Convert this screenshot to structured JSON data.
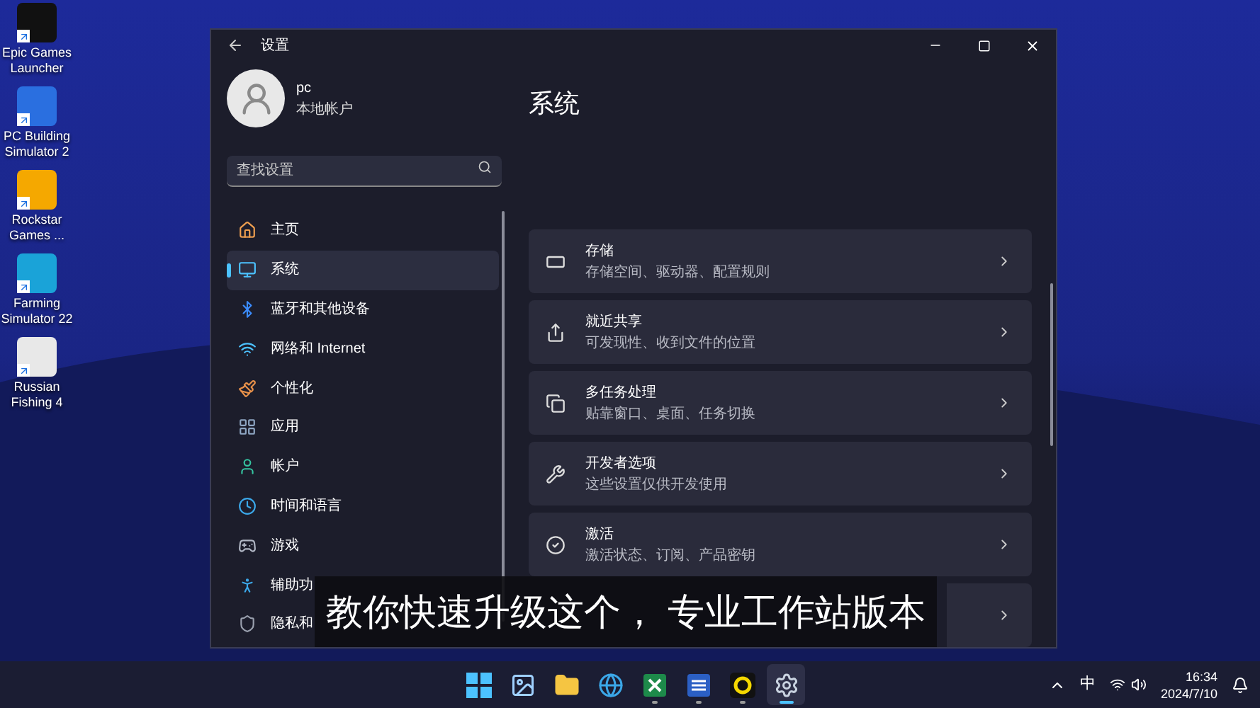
{
  "desktop_icons": [
    {
      "label": "Epic Games Launcher",
      "color": "#111111"
    },
    {
      "label": "PC Building Simulator 2",
      "color": "#2a6fe0"
    },
    {
      "label": "Rockstar Games ...",
      "color": "#f5a800"
    },
    {
      "label": "Farming Simulator 22",
      "color": "#1aa3d8"
    },
    {
      "label": "Russian Fishing 4",
      "color": "#e8e8e8"
    }
  ],
  "window": {
    "title": "设置",
    "user": {
      "name": "pc",
      "account_type": "本地帐户"
    },
    "search": {
      "placeholder": "查找设置"
    },
    "nav_items": [
      {
        "label": "主页",
        "selected": false
      },
      {
        "label": "系统",
        "selected": true
      },
      {
        "label": "蓝牙和其他设备",
        "selected": false
      },
      {
        "label": "网络和 Internet",
        "selected": false
      },
      {
        "label": "个性化",
        "selected": false
      },
      {
        "label": "应用",
        "selected": false
      },
      {
        "label": "帐户",
        "selected": false
      },
      {
        "label": "时间和语言",
        "selected": false
      },
      {
        "label": "游戏",
        "selected": false
      },
      {
        "label": "辅助功",
        "selected": false
      },
      {
        "label": "隐私和",
        "selected": false
      }
    ],
    "page_title": "系统",
    "cards": [
      {
        "title": "存储",
        "subtitle": "存储空间、驱动器、配置规则"
      },
      {
        "title": "就近共享",
        "subtitle": "可发现性、收到文件的位置"
      },
      {
        "title": "多任务处理",
        "subtitle": "贴靠窗口、桌面、任务切换"
      },
      {
        "title": "开发者选项",
        "subtitle": "这些设置仅供开发使用"
      },
      {
        "title": "激活",
        "subtitle": "激活状态、订阅、产品密钥",
        "kind": "full"
      },
      {
        "kind": "covered"
      }
    ]
  },
  "subtitle": "教你快速升级这个， 专业工作站版本",
  "taskbar": {
    "apps": [
      {
        "running": false,
        "selected": false
      },
      {
        "running": false,
        "selected": false
      },
      {
        "running": false,
        "selected": false
      },
      {
        "running": false,
        "selected": false
      },
      {
        "running": true,
        "selected": false
      },
      {
        "running": true,
        "selected": false
      },
      {
        "running": true,
        "selected": false
      },
      {
        "running": true,
        "selected": true
      }
    ],
    "input_method": "中",
    "time": "16:34",
    "date": "2024/7/10"
  }
}
